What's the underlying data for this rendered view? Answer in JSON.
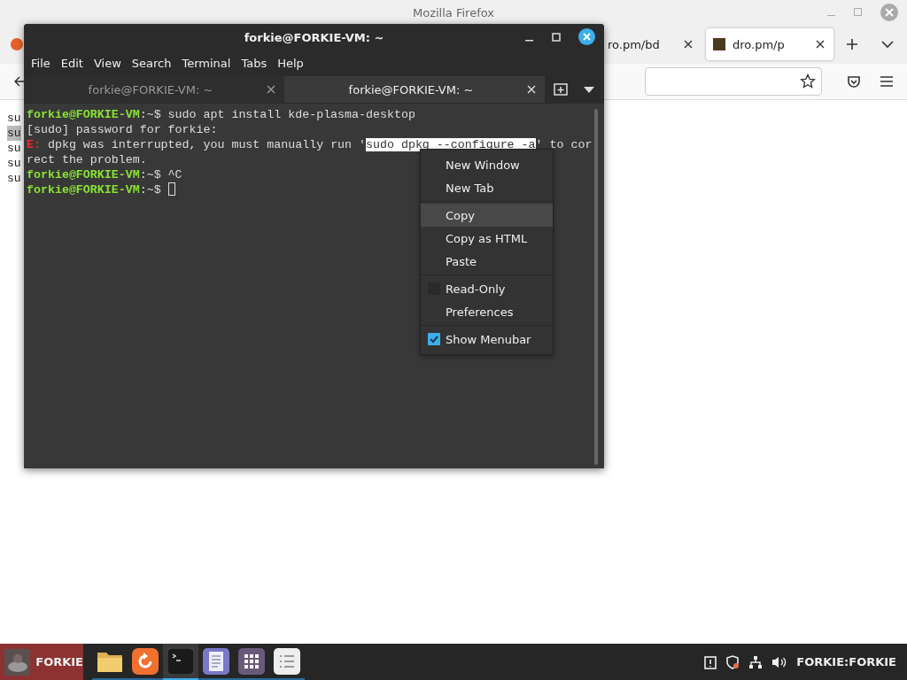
{
  "browser": {
    "title": "Mozilla Firefox",
    "tabs": [
      {
        "label": "ro.pm/bd",
        "selected": false
      },
      {
        "label": "dro.pm/p",
        "selected": true
      }
    ],
    "page_lines": [
      {
        "text": "su",
        "selected": false
      },
      {
        "text": "su",
        "selected": true
      },
      {
        "text": "su",
        "selected": false
      },
      {
        "text": "su",
        "selected": false
      },
      {
        "text": "su",
        "selected": false
      }
    ]
  },
  "terminal": {
    "title": "forkie@FORKIE-VM: ~",
    "menu": [
      "File",
      "Edit",
      "View",
      "Search",
      "Terminal",
      "Tabs",
      "Help"
    ],
    "tabs": [
      {
        "label": "forkie@FORKIE-VM: ~",
        "selected": false
      },
      {
        "label": "forkie@FORKIE-VM: ~",
        "selected": true
      }
    ],
    "lines": [
      [
        {
          "text": "forkie@FORKIE-VM",
          "kind": "prompt"
        },
        {
          "text": ":~$ sudo apt install kde-plasma-desktop",
          "kind": "plain"
        }
      ],
      [
        {
          "text": "[sudo] password for forkie:",
          "kind": "plain"
        }
      ],
      [
        {
          "text": "E:",
          "kind": "error"
        },
        {
          "text": " dpkg was interrupted, you must manually run '",
          "kind": "plain"
        },
        {
          "text": "sudo dpkg --configure -a",
          "kind": "selected"
        },
        {
          "text": "' to cor",
          "kind": "plain"
        }
      ],
      [
        {
          "text": "rect the problem.",
          "kind": "plain"
        }
      ],
      [
        {
          "text": "forkie@FORKIE-VM",
          "kind": "prompt"
        },
        {
          "text": ":~$ ^C",
          "kind": "plain"
        }
      ],
      [
        {
          "text": "forkie@FORKIE-VM",
          "kind": "prompt"
        },
        {
          "text": ":~$ ",
          "kind": "plain"
        },
        {
          "kind": "cursor"
        }
      ]
    ],
    "context_menu": [
      {
        "kind": "item",
        "label": "New Window",
        "highlighted": false
      },
      {
        "kind": "item",
        "label": "New Tab",
        "highlighted": false
      },
      {
        "kind": "separator"
      },
      {
        "kind": "item",
        "label": "Copy",
        "highlighted": true
      },
      {
        "kind": "item",
        "label": "Copy as HTML",
        "highlighted": false
      },
      {
        "kind": "item",
        "label": "Paste",
        "highlighted": false
      },
      {
        "kind": "separator"
      },
      {
        "kind": "check",
        "label": "Read-Only",
        "checked": false
      },
      {
        "kind": "item",
        "label": "Preferences",
        "highlighted": false
      },
      {
        "kind": "separator"
      },
      {
        "kind": "check",
        "label": "Show Menubar",
        "checked": true
      }
    ]
  },
  "taskbar": {
    "start_label": "FORKIE",
    "user": "FORKIE:FORKIE",
    "apps": [
      {
        "kind": "folder",
        "active": false
      },
      {
        "kind": "updater",
        "active": false
      },
      {
        "kind": "terminal",
        "active": true
      },
      {
        "kind": "document",
        "active": false
      },
      {
        "kind": "apps",
        "active": false
      },
      {
        "kind": "list",
        "active": false
      }
    ]
  }
}
